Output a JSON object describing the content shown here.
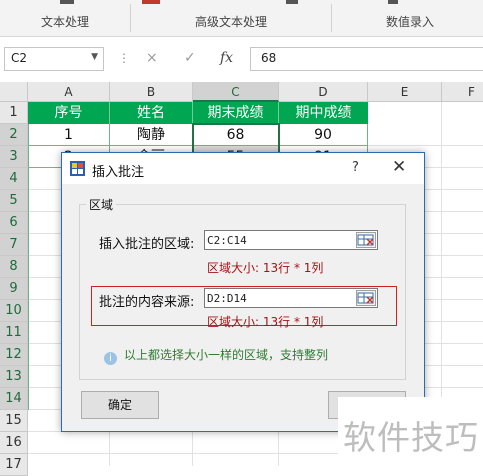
{
  "ribbon": {
    "groups": [
      "文本处理",
      "高级文本处理",
      "数值录入"
    ]
  },
  "formula_bar": {
    "name_box": "C2",
    "cancel_icon": "×",
    "confirm_icon": "✓",
    "fx_icon": "fx",
    "value": "68"
  },
  "sheet": {
    "columns": [
      "A",
      "B",
      "C",
      "D",
      "E",
      "F"
    ],
    "rows": [
      "1",
      "2",
      "3",
      "4",
      "5",
      "6",
      "7",
      "8",
      "9",
      "10",
      "11",
      "12",
      "13",
      "14",
      "15",
      "16",
      "17"
    ],
    "header_row": [
      "序号",
      "姓名",
      "期末成绩",
      "期中成绩"
    ],
    "row2": [
      "1",
      "陶静",
      "68",
      "90"
    ],
    "row3_partial": [
      "2",
      "金丽",
      "55",
      "91"
    ],
    "colors": {
      "header_green": "#00a651",
      "selection": "#217346"
    }
  },
  "dialog": {
    "title": "插入批注",
    "help": "?",
    "close": "✕",
    "group_label": "区域",
    "insert_label": "插入批注的区域:",
    "insert_value": "C2:C14",
    "insert_size": "区域大小: 13行 * 1列",
    "source_label": "批注的内容来源:",
    "source_value": "D2:D14",
    "source_size": "区域大小: 13行 * 1列",
    "info_text": "以上都选择大小一样的区域，支持整列",
    "ok_button": "确定",
    "cancel_button": ""
  },
  "watermark": "软件技巧"
}
